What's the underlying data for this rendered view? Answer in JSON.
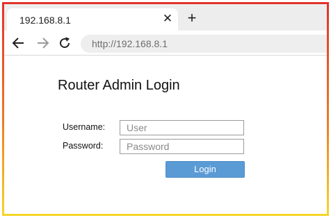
{
  "browser": {
    "tab": {
      "title": "192.168.8.1",
      "close_symbol": "✕"
    },
    "new_tab_symbol": "+",
    "address_bar": {
      "url": "http://192.168.8.1"
    },
    "icons": [
      "back-arrow-icon",
      "forward-arrow-icon",
      "reload-icon",
      "close-icon",
      "plus-icon"
    ]
  },
  "login": {
    "title": "Router Admin Login",
    "username_label": "Username:",
    "username_placeholder": "User",
    "password_label": "Password:",
    "password_placeholder": "Password",
    "submit_label": "Login"
  },
  "colors": {
    "frame_gradient": [
      "#e4312a",
      "#ee7a22",
      "#f5d52a"
    ],
    "button": "#5b9bd5"
  }
}
